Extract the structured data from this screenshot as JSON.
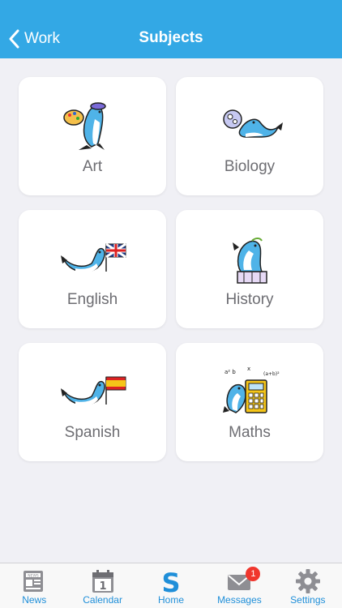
{
  "header": {
    "back_label": "Work",
    "title": "Subjects",
    "color": "#33a8e5"
  },
  "subjects": [
    {
      "label": "Art",
      "icon": "seal-artist-icon"
    },
    {
      "label": "Biology",
      "icon": "seal-microscope-icon"
    },
    {
      "label": "English",
      "icon": "seal-uk-flag-icon"
    },
    {
      "label": "History",
      "icon": "seal-statue-icon"
    },
    {
      "label": "Spanish",
      "icon": "seal-spain-flag-icon"
    },
    {
      "label": "Maths",
      "icon": "seal-calculator-icon"
    }
  ],
  "tabbar": {
    "items": [
      {
        "label": "News",
        "icon": "newspaper-icon"
      },
      {
        "label": "Calendar",
        "icon": "calendar-icon",
        "day": "1"
      },
      {
        "label": "Home",
        "icon": "home-s-logo-icon",
        "glyph": "S"
      },
      {
        "label": "Messages",
        "icon": "envelope-icon",
        "badge": "1"
      },
      {
        "label": "Settings",
        "icon": "gear-icon"
      }
    ],
    "active_color": "#1f8fd9"
  }
}
